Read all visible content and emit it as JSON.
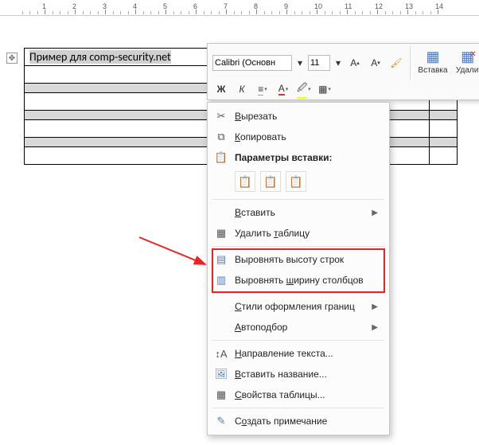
{
  "document": {
    "cell_text": "Пример для comp-security.net"
  },
  "ruler": {
    "numbers": [
      1,
      2,
      3,
      4,
      5,
      6,
      7,
      8,
      9,
      10,
      11,
      12,
      13,
      14
    ]
  },
  "mini_toolbar": {
    "font_name": "Calibri (Основн",
    "font_size": "11",
    "insert_label": "Вставка",
    "delete_label": "Удалить"
  },
  "context_menu": {
    "cut": "Вырезать",
    "copy": "Копировать",
    "paste_options": "Параметры вставки:",
    "paste": "Вставить",
    "delete_table": "Удалить таблицу",
    "even_row_height": "Выровнять высоту строк",
    "even_col_width": "Выровнять ширину столбцов",
    "border_styles": "Стили оформления границ",
    "autofit": "Автоподбор",
    "text_direction": "Направление текста...",
    "insert_caption": "Вставить название...",
    "table_properties": "Свойства таблицы...",
    "new_comment": "Создать примечание"
  }
}
